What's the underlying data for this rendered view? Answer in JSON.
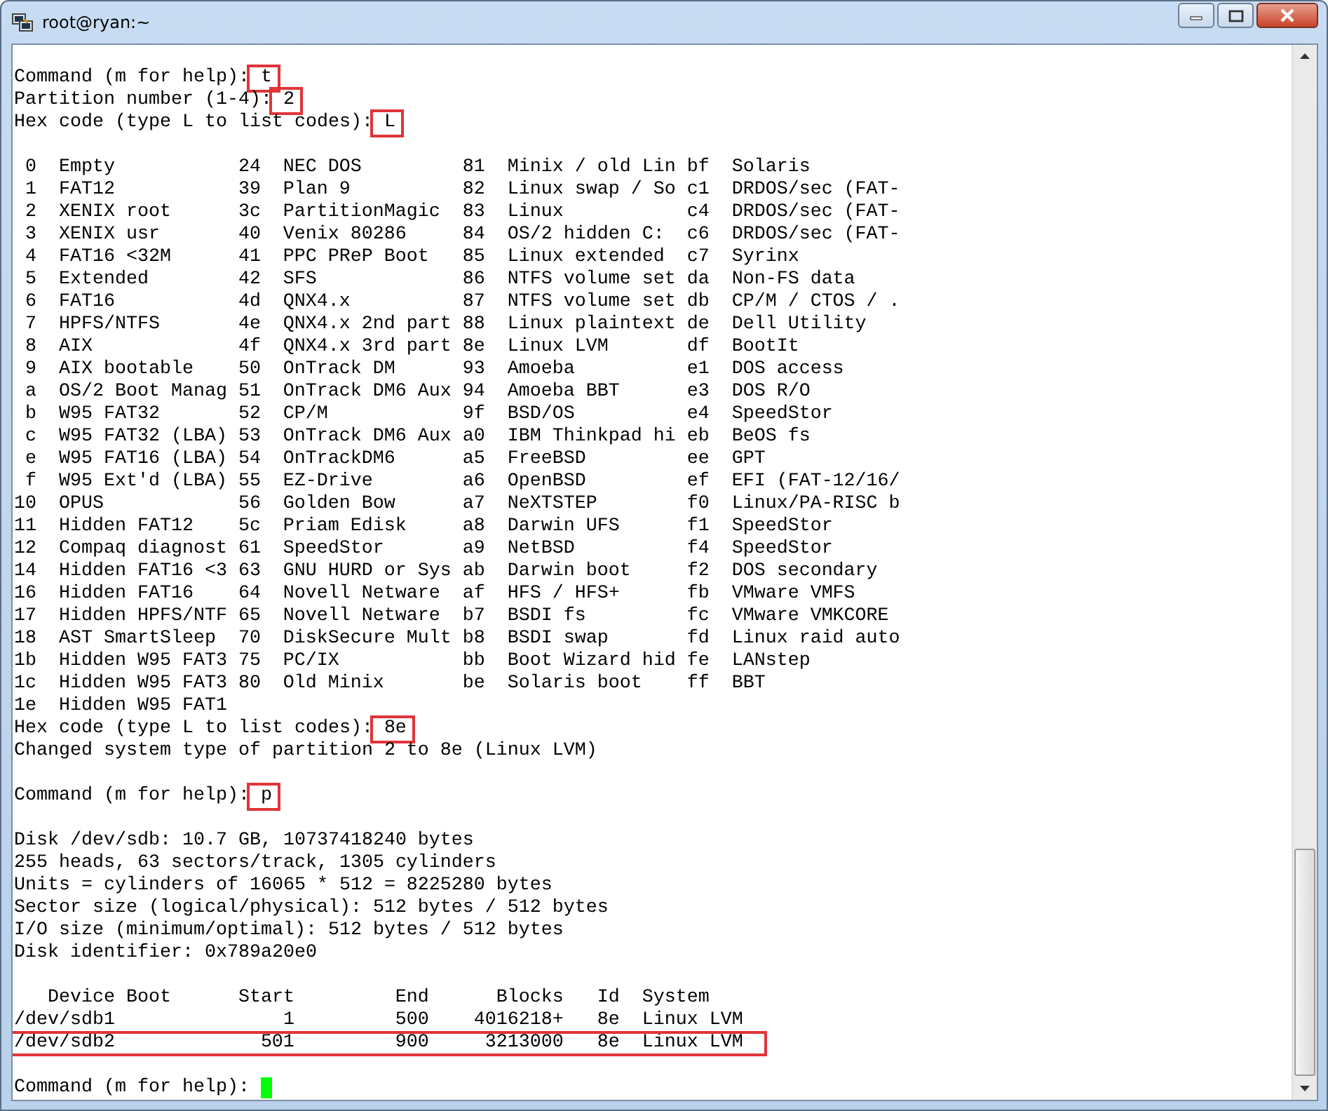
{
  "window": {
    "title": "root@ryan:~"
  },
  "terminal": {
    "lines": [
      {
        "kind": "prompt",
        "prompt": "Command (m for help):",
        "input": "t",
        "highlighted": true
      },
      {
        "kind": "prompt",
        "prompt": "Partition number (1-4):",
        "input": "2",
        "highlighted": true
      },
      {
        "kind": "prompt",
        "prompt": "Hex code (type L to list codes):",
        "input": "L",
        "highlighted": true
      },
      {
        "kind": "blank"
      },
      {
        "kind": "code_table",
        "rows": [
          [
            [
              "0",
              "Empty"
            ],
            [
              "24",
              "NEC DOS"
            ],
            [
              "81",
              "Minix / old Lin"
            ],
            [
              "bf",
              "Solaris"
            ]
          ],
          [
            [
              "1",
              "FAT12"
            ],
            [
              "39",
              "Plan 9"
            ],
            [
              "82",
              "Linux swap / So"
            ],
            [
              "c1",
              "DRDOS/sec (FAT-"
            ]
          ],
          [
            [
              "2",
              "XENIX root"
            ],
            [
              "3c",
              "PartitionMagic"
            ],
            [
              "83",
              "Linux"
            ],
            [
              "c4",
              "DRDOS/sec (FAT-"
            ]
          ],
          [
            [
              "3",
              "XENIX usr"
            ],
            [
              "40",
              "Venix 80286"
            ],
            [
              "84",
              "OS/2 hidden C:"
            ],
            [
              "c6",
              "DRDOS/sec (FAT-"
            ]
          ],
          [
            [
              "4",
              "FAT16 <32M"
            ],
            [
              "41",
              "PPC PReP Boot"
            ],
            [
              "85",
              "Linux extended"
            ],
            [
              "c7",
              "Syrinx"
            ]
          ],
          [
            [
              "5",
              "Extended"
            ],
            [
              "42",
              "SFS"
            ],
            [
              "86",
              "NTFS volume set"
            ],
            [
              "da",
              "Non-FS data"
            ]
          ],
          [
            [
              "6",
              "FAT16"
            ],
            [
              "4d",
              "QNX4.x"
            ],
            [
              "87",
              "NTFS volume set"
            ],
            [
              "db",
              "CP/M / CTOS / ."
            ]
          ],
          [
            [
              "7",
              "HPFS/NTFS"
            ],
            [
              "4e",
              "QNX4.x 2nd part"
            ],
            [
              "88",
              "Linux plaintext"
            ],
            [
              "de",
              "Dell Utility"
            ]
          ],
          [
            [
              "8",
              "AIX"
            ],
            [
              "4f",
              "QNX4.x 3rd part"
            ],
            [
              "8e",
              "Linux LVM"
            ],
            [
              "df",
              "BootIt"
            ]
          ],
          [
            [
              "9",
              "AIX bootable"
            ],
            [
              "50",
              "OnTrack DM"
            ],
            [
              "93",
              "Amoeba"
            ],
            [
              "e1",
              "DOS access"
            ]
          ],
          [
            [
              "a",
              "OS/2 Boot Manag"
            ],
            [
              "51",
              "OnTrack DM6 Aux"
            ],
            [
              "94",
              "Amoeba BBT"
            ],
            [
              "e3",
              "DOS R/O"
            ]
          ],
          [
            [
              "b",
              "W95 FAT32"
            ],
            [
              "52",
              "CP/M"
            ],
            [
              "9f",
              "BSD/OS"
            ],
            [
              "e4",
              "SpeedStor"
            ]
          ],
          [
            [
              "c",
              "W95 FAT32 (LBA)"
            ],
            [
              "53",
              "OnTrack DM6 Aux"
            ],
            [
              "a0",
              "IBM Thinkpad hi"
            ],
            [
              "eb",
              "BeOS fs"
            ]
          ],
          [
            [
              "e",
              "W95 FAT16 (LBA)"
            ],
            [
              "54",
              "OnTrackDM6"
            ],
            [
              "a5",
              "FreeBSD"
            ],
            [
              "ee",
              "GPT"
            ]
          ],
          [
            [
              "f",
              "W95 Ext'd (LBA)"
            ],
            [
              "55",
              "EZ-Drive"
            ],
            [
              "a6",
              "OpenBSD"
            ],
            [
              "ef",
              "EFI (FAT-12/16/"
            ]
          ],
          [
            [
              "10",
              "OPUS"
            ],
            [
              "56",
              "Golden Bow"
            ],
            [
              "a7",
              "NeXTSTEP"
            ],
            [
              "f0",
              "Linux/PA-RISC b"
            ]
          ],
          [
            [
              "11",
              "Hidden FAT12"
            ],
            [
              "5c",
              "Priam Edisk"
            ],
            [
              "a8",
              "Darwin UFS"
            ],
            [
              "f1",
              "SpeedStor"
            ]
          ],
          [
            [
              "12",
              "Compaq diagnost"
            ],
            [
              "61",
              "SpeedStor"
            ],
            [
              "a9",
              "NetBSD"
            ],
            [
              "f4",
              "SpeedStor"
            ]
          ],
          [
            [
              "14",
              "Hidden FAT16 <3"
            ],
            [
              "63",
              "GNU HURD or Sys"
            ],
            [
              "ab",
              "Darwin boot"
            ],
            [
              "f2",
              "DOS secondary"
            ]
          ],
          [
            [
              "16",
              "Hidden FAT16"
            ],
            [
              "64",
              "Novell Netware"
            ],
            [
              "af",
              "HFS / HFS+"
            ],
            [
              "fb",
              "VMware VMFS"
            ]
          ],
          [
            [
              "17",
              "Hidden HPFS/NTF"
            ],
            [
              "65",
              "Novell Netware"
            ],
            [
              "b7",
              "BSDI fs"
            ],
            [
              "fc",
              "VMware VMKCORE"
            ]
          ],
          [
            [
              "18",
              "AST SmartSleep"
            ],
            [
              "70",
              "DiskSecure Mult"
            ],
            [
              "b8",
              "BSDI swap"
            ],
            [
              "fd",
              "Linux raid auto"
            ]
          ],
          [
            [
              "1b",
              "Hidden W95 FAT3"
            ],
            [
              "75",
              "PC/IX"
            ],
            [
              "bb",
              "Boot Wizard hid"
            ],
            [
              "fe",
              "LANstep"
            ]
          ],
          [
            [
              "1c",
              "Hidden W95 FAT3"
            ],
            [
              "80",
              "Old Minix"
            ],
            [
              "be",
              "Solaris boot"
            ],
            [
              "ff",
              "BBT"
            ]
          ],
          [
            [
              "1e",
              "Hidden W95 FAT1"
            ]
          ]
        ]
      },
      {
        "kind": "prompt",
        "prompt": "Hex code (type L to list codes):",
        "input": "8e",
        "highlighted": true
      },
      {
        "kind": "text",
        "text": "Changed system type of partition 2 to 8e (Linux LVM)"
      },
      {
        "kind": "blank"
      },
      {
        "kind": "prompt",
        "prompt": "Command (m for help):",
        "input": "p",
        "highlighted": true
      },
      {
        "kind": "blank"
      },
      {
        "kind": "text",
        "text": "Disk /dev/sdb: 10.7 GB, 10737418240 bytes"
      },
      {
        "kind": "text",
        "text": "255 heads, 63 sectors/track, 1305 cylinders"
      },
      {
        "kind": "text",
        "text": "Units = cylinders of 16065 * 512 = 8225280 bytes"
      },
      {
        "kind": "text",
        "text": "Sector size (logical/physical): 512 bytes / 512 bytes"
      },
      {
        "kind": "text",
        "text": "I/O size (minimum/optimal): 512 bytes / 512 bytes"
      },
      {
        "kind": "text",
        "text": "Disk identifier: 0x789a20e0"
      },
      {
        "kind": "blank"
      },
      {
        "kind": "partition_table",
        "columns": [
          "Device Boot",
          "Start",
          "End",
          "Blocks",
          "Id",
          "System"
        ],
        "rows": [
          {
            "cells": [
              "/dev/sdb1",
              "1",
              "500",
              "4016218+",
              "8e",
              "Linux LVM"
            ],
            "highlighted": false
          },
          {
            "cells": [
              "/dev/sdb2",
              "501",
              "900",
              "3213000",
              "8e",
              "Linux LVM"
            ],
            "highlighted": true
          }
        ]
      },
      {
        "kind": "blank"
      },
      {
        "kind": "cursor_prompt",
        "prompt": "Command (m for help):"
      }
    ]
  }
}
